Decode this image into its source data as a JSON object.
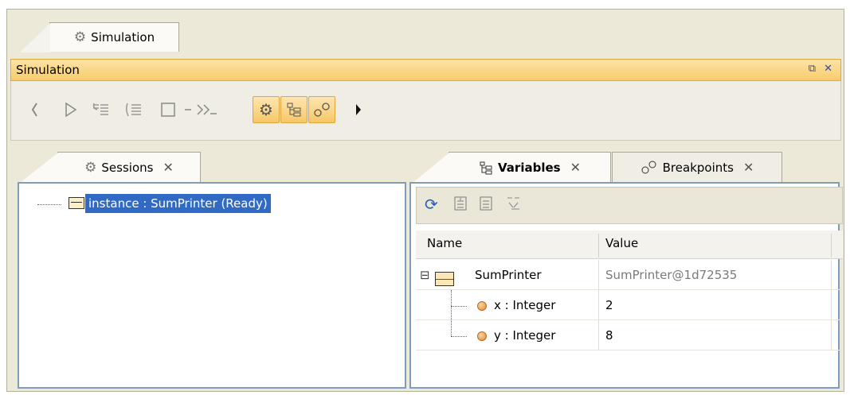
{
  "main_tab": {
    "label": "Simulation"
  },
  "simulation_panel": {
    "title": "Simulation",
    "restore_glyph": "⧉",
    "close_glyph": "✕"
  },
  "toolbar": {
    "buttons": [
      {
        "name": "step-back-icon"
      },
      {
        "name": "run-icon"
      },
      {
        "name": "step-into-icon"
      },
      {
        "name": "step-over-icon"
      },
      {
        "name": "stop-icon"
      },
      {
        "name": "animation-speed-icon"
      },
      {
        "name": "sessions-toggle-icon",
        "active": true
      },
      {
        "name": "variables-toggle-icon",
        "active": true
      },
      {
        "name": "breakpoints-toggle-icon",
        "active": true
      },
      {
        "name": "more-icon"
      }
    ]
  },
  "sessions_tab": {
    "label": "Sessions",
    "close": "✕"
  },
  "variables_tab": {
    "label": "Variables",
    "close": "✕"
  },
  "breakpoints_tab": {
    "label": "Breakpoints",
    "close": "✕"
  },
  "sessions_tree": {
    "item": "instance : SumPrinter (Ready)"
  },
  "variables_grid": {
    "columns": [
      "Name",
      "Value"
    ],
    "rows": [
      {
        "name": "SumPrinter",
        "value": "SumPrinter@1d72535",
        "expander": "⊟"
      },
      {
        "name": "x : Integer",
        "value": "2"
      },
      {
        "name": "y : Integer",
        "value": "8"
      }
    ]
  },
  "colors": {
    "accent": "#f8cc6c",
    "selection": "#316ac5"
  }
}
